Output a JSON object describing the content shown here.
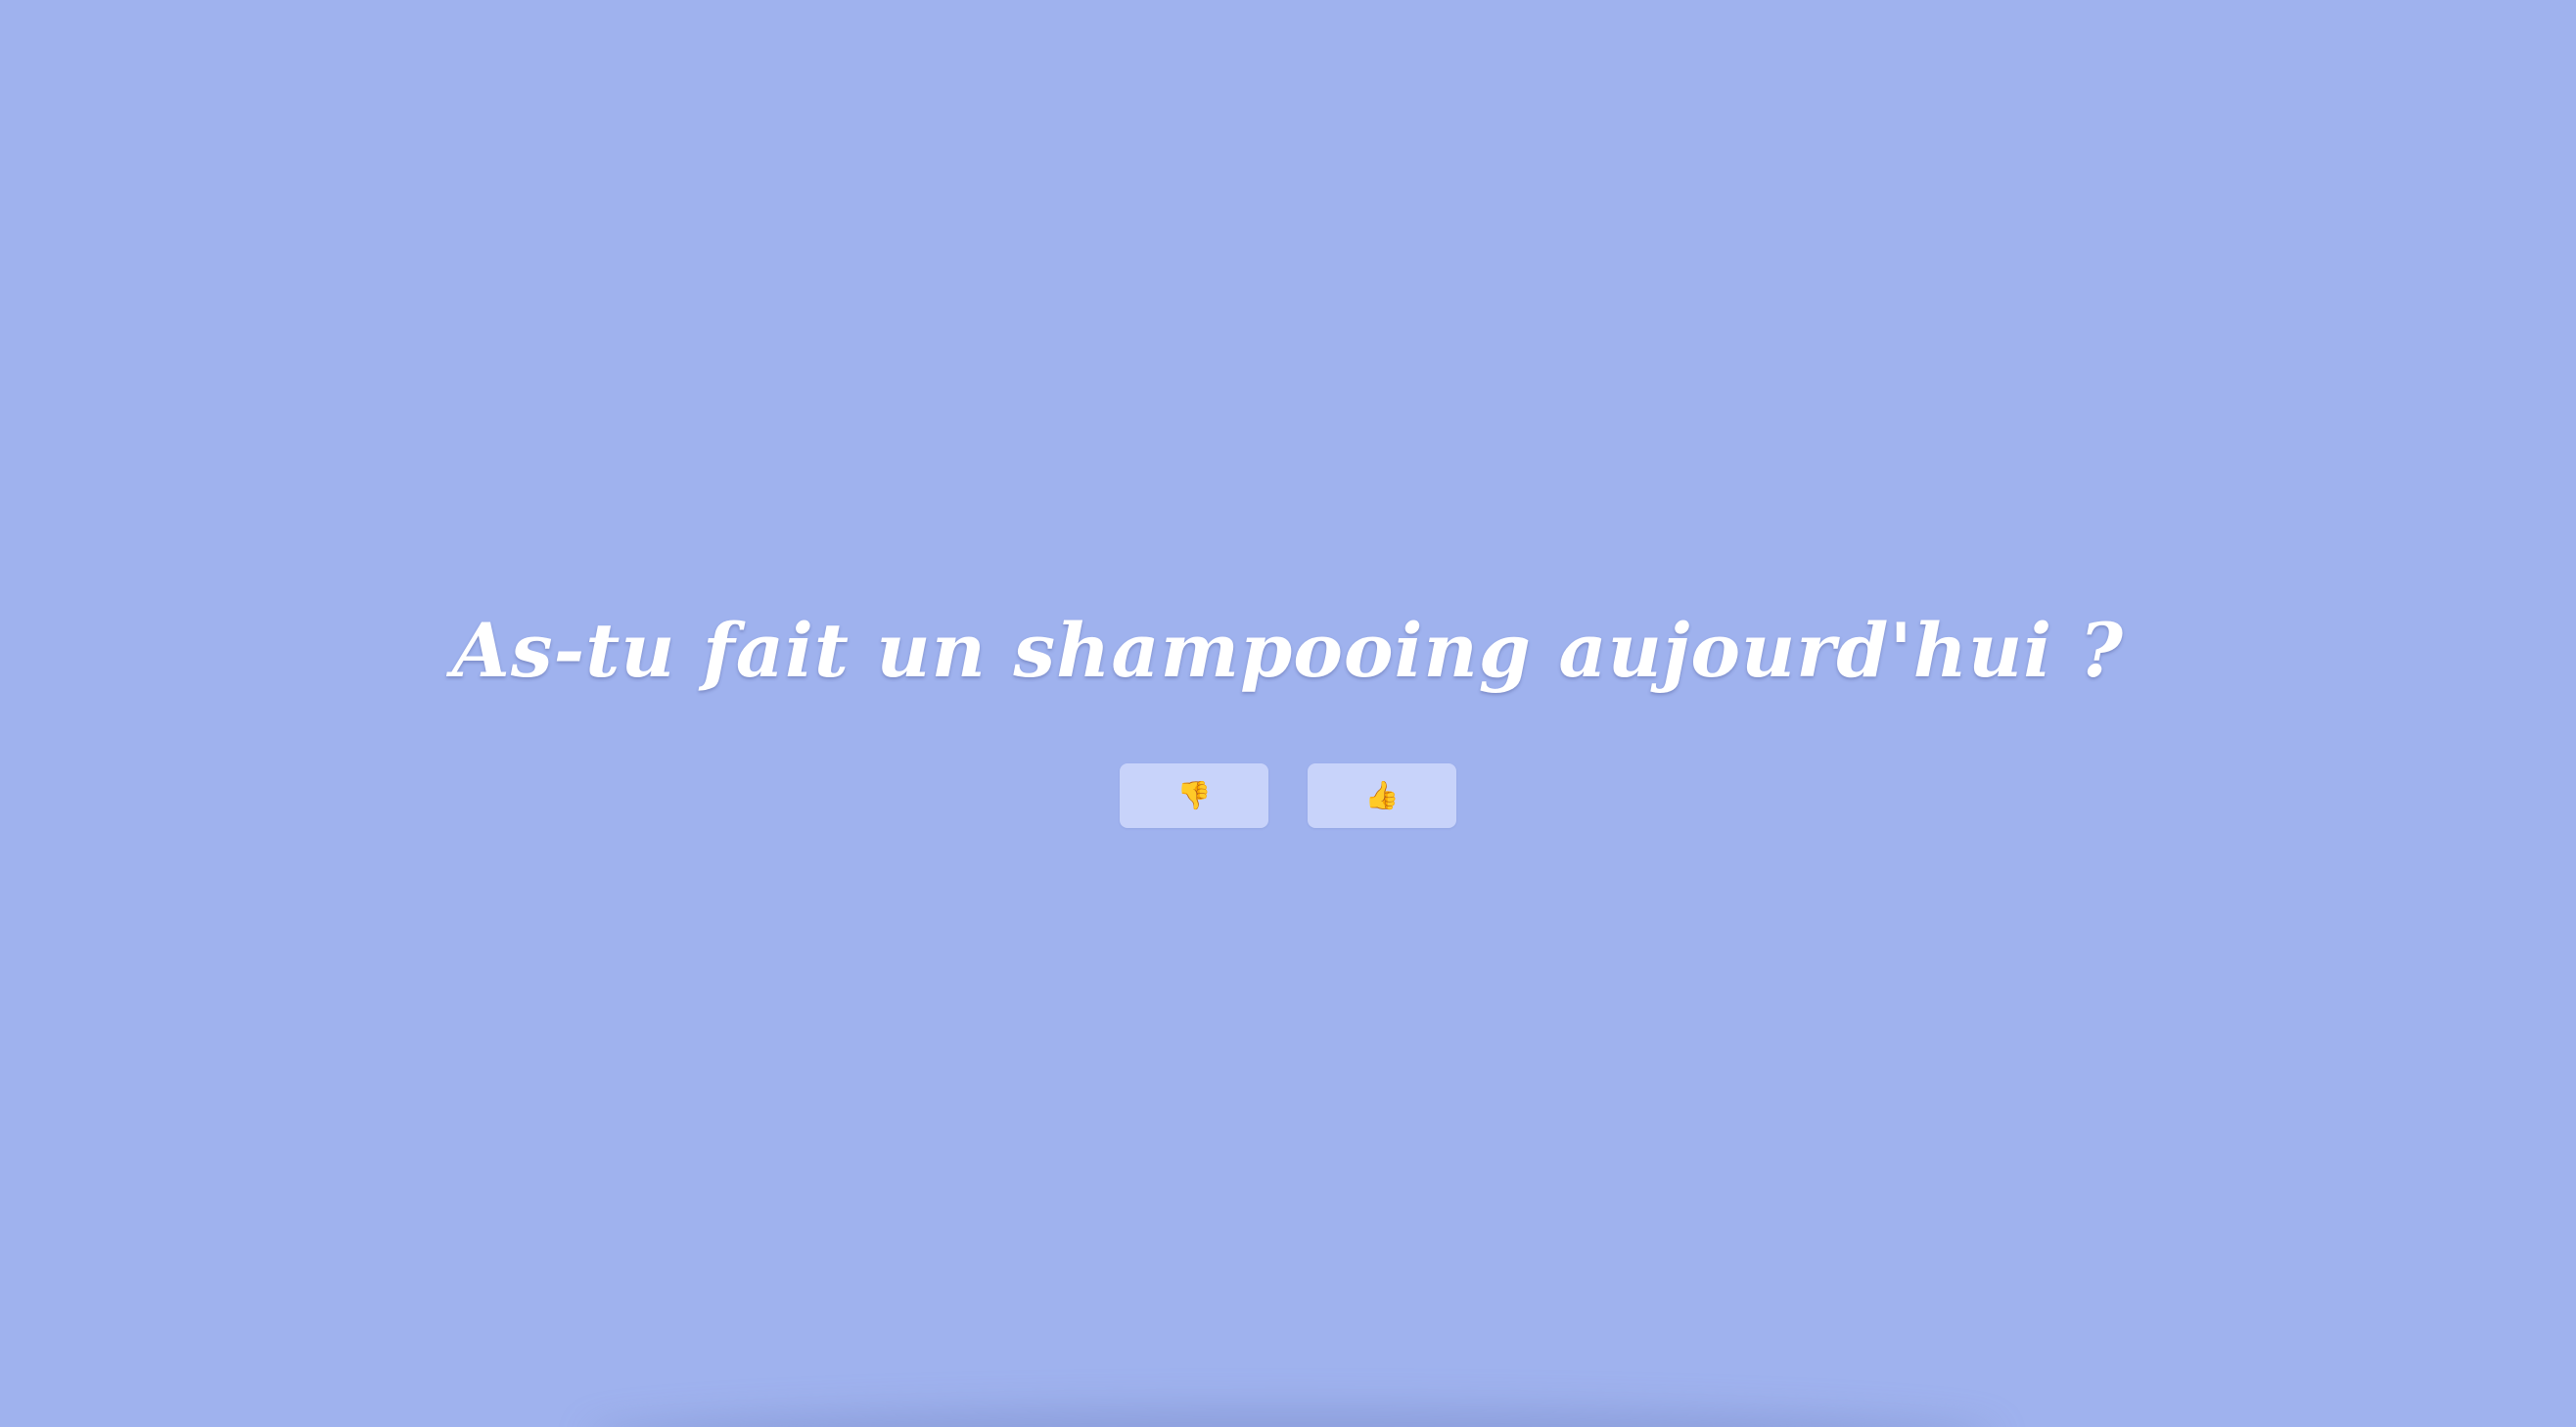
{
  "question": {
    "text": "As-tu fait un shampooing aujourd'hui ?"
  },
  "buttons": {
    "no": {
      "label": "👎",
      "icon": "thumbs-down-icon"
    },
    "yes": {
      "label": "👍",
      "icon": "thumbs-up-icon"
    }
  },
  "colors": {
    "background": "#9fb2ee",
    "button": "#c8d3fa",
    "text": "#ffffff"
  }
}
